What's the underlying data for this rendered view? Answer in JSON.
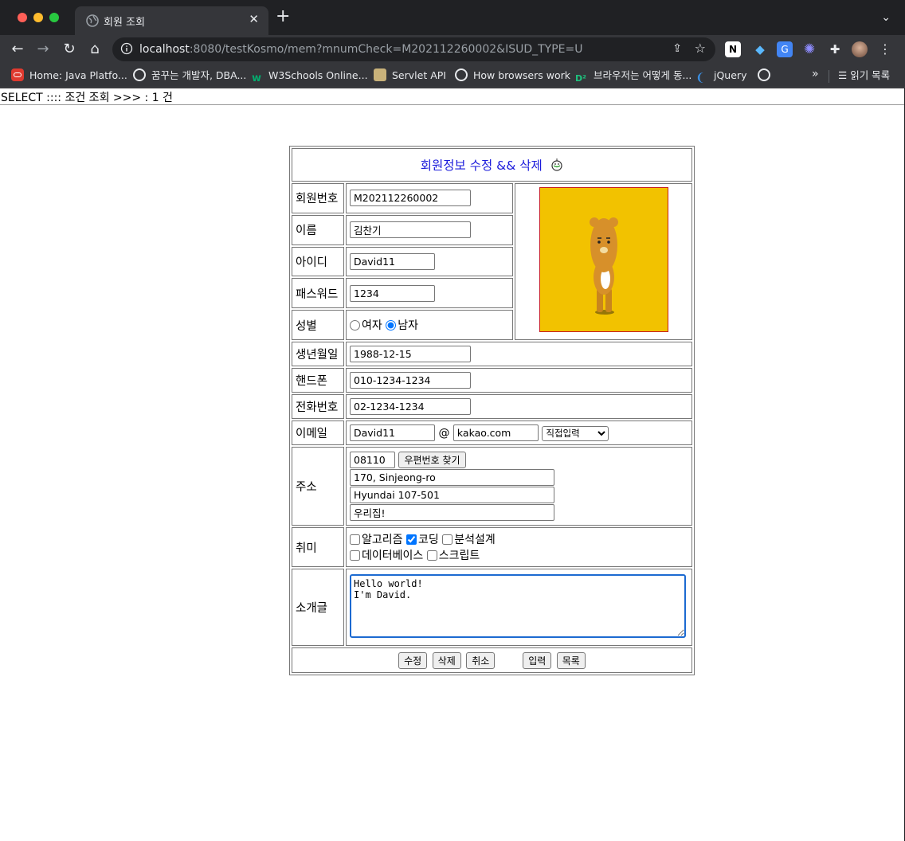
{
  "browser": {
    "tab_title": "회원 조회",
    "url_host": "localhost",
    "url_rest": ":8080/testKosmo/mem?mnumCheck=M202112260002&ISUD_TYPE=U",
    "bookmarks": [
      {
        "label": "Home: Java Platfo...",
        "icon": "oracle-icon"
      },
      {
        "label": "꿈꾸는 개발자, DBA...",
        "icon": "globe-icon"
      },
      {
        "label": "W3Schools Online...",
        "icon": "w3schools-icon"
      },
      {
        "label": "Servlet API",
        "icon": "servlet-icon"
      },
      {
        "label": "How browsers work",
        "icon": "globe-icon"
      },
      {
        "label": "브라우저는 어떻게 동...",
        "icon": "d2-icon"
      },
      {
        "label": "jQuery",
        "icon": "jquery-icon"
      }
    ],
    "reading_list": "읽기 목록"
  },
  "page": {
    "select_line": "SELECT :::: 조건 조회 >>> : 1 건",
    "form_title": "회원정보 수정 && 삭제",
    "labels": {
      "mnum": "회원번호",
      "name": "이름",
      "id": "아이디",
      "pw": "패스워드",
      "gender": "성별",
      "birth": "생년월일",
      "hp": "핸드폰",
      "tel": "전화번호",
      "email": "이메일",
      "addr": "주소",
      "hobby": "취미",
      "intro": "소개글"
    },
    "values": {
      "mnum": "M202112260002",
      "name": "김찬기",
      "id": "David11",
      "pw": "1234",
      "birth": "1988-12-15",
      "hp": "010-1234-1234",
      "tel": "02-1234-1234",
      "email_id": "David11",
      "email_at": "@",
      "email_domain": "kakao.com",
      "email_select": "직접입력",
      "zip": "08110",
      "addr1": "170, Sinjeong-ro",
      "addr2": "Hyundai 107-501",
      "addr3": "우리집!",
      "intro": "Hello world!\nI'm David."
    },
    "gender": {
      "female": "여자",
      "male": "남자",
      "selected": "male"
    },
    "hobbies": [
      {
        "label": "알고리즘",
        "checked": false
      },
      {
        "label": "코딩",
        "checked": true
      },
      {
        "label": "분석설계",
        "checked": false
      },
      {
        "label": "데이터베이스",
        "checked": false
      },
      {
        "label": "스크립트",
        "checked": false
      }
    ],
    "buttons": {
      "zip_search": "우편번호 찾기",
      "update": "수정",
      "delete": "삭제",
      "cancel": "취소",
      "insert": "입력",
      "list": "목록"
    }
  },
  "colors": {
    "title": "#1a1adb",
    "photo_bg": "#f2c200",
    "photo_border": "#c71d1d",
    "textarea_focus": "#1c6ad1"
  }
}
